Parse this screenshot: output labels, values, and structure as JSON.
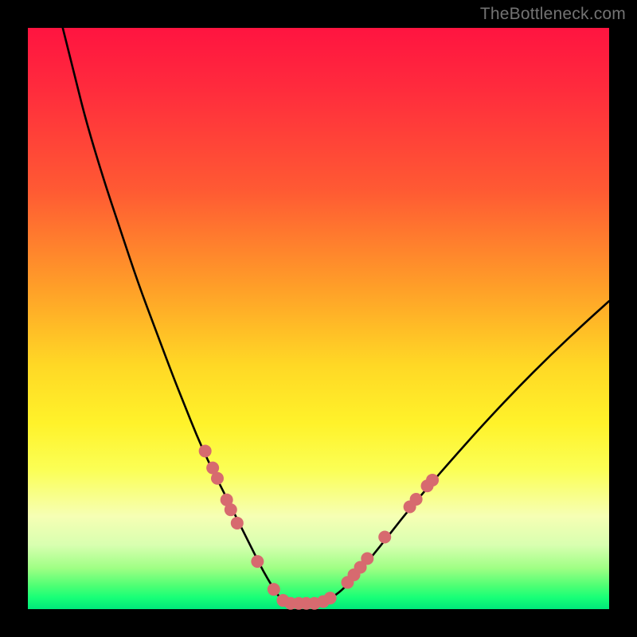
{
  "watermark": "TheBottleneck.com",
  "colors": {
    "background_frame": "#000000",
    "gradient_top": "#ff1440",
    "gradient_bottom": "#00e87a",
    "curve": "#000000",
    "marker_fill": "#d76a6f",
    "marker_stroke": "#b24e53"
  },
  "chart_data": {
    "type": "line",
    "title": "",
    "xlabel": "",
    "ylabel": "",
    "xlim": [
      0,
      100
    ],
    "ylim": [
      0,
      100
    ],
    "grid": false,
    "legend": false,
    "series": [
      {
        "name": "bottleneck-curve",
        "x": [
          6,
          8,
          10,
          13,
          16,
          19,
          22,
          25,
          27,
          29,
          31,
          33,
          35,
          37,
          39,
          40.5,
          42,
          43,
          44,
          45,
          46,
          48,
          50,
          52,
          54,
          56,
          59,
          62,
          65,
          69,
          73,
          78,
          84,
          90,
          96,
          100
        ],
        "y": [
          100,
          92,
          84,
          74,
          65,
          56,
          48,
          40,
          35,
          30,
          25.5,
          21.5,
          17.5,
          13.5,
          9.5,
          6.5,
          4,
          2.4,
          1.4,
          1.0,
          1.0,
          1.0,
          1.2,
          1.8,
          3.2,
          5.4,
          8.8,
          12.6,
          16.4,
          21.2,
          25.8,
          31.4,
          37.8,
          43.8,
          49.4,
          53.0
        ]
      }
    ],
    "markers": [
      {
        "x": 30.5,
        "y": 27.2
      },
      {
        "x": 31.8,
        "y": 24.3
      },
      {
        "x": 32.6,
        "y": 22.5
      },
      {
        "x": 34.2,
        "y": 18.8
      },
      {
        "x": 34.9,
        "y": 17.1
      },
      {
        "x": 36.0,
        "y": 14.8
      },
      {
        "x": 39.5,
        "y": 8.2
      },
      {
        "x": 42.3,
        "y": 3.4
      },
      {
        "x": 43.9,
        "y": 1.5
      },
      {
        "x": 45.2,
        "y": 1.0
      },
      {
        "x": 46.6,
        "y": 1.0
      },
      {
        "x": 47.9,
        "y": 1.0
      },
      {
        "x": 49.3,
        "y": 1.0
      },
      {
        "x": 50.8,
        "y": 1.3
      },
      {
        "x": 52.0,
        "y": 1.9
      },
      {
        "x": 55.0,
        "y": 4.6
      },
      {
        "x": 56.1,
        "y": 5.9
      },
      {
        "x": 57.2,
        "y": 7.2
      },
      {
        "x": 58.4,
        "y": 8.7
      },
      {
        "x": 61.4,
        "y": 12.4
      },
      {
        "x": 65.7,
        "y": 17.6
      },
      {
        "x": 66.8,
        "y": 18.9
      },
      {
        "x": 68.7,
        "y": 21.2
      },
      {
        "x": 69.6,
        "y": 22.2
      }
    ]
  }
}
